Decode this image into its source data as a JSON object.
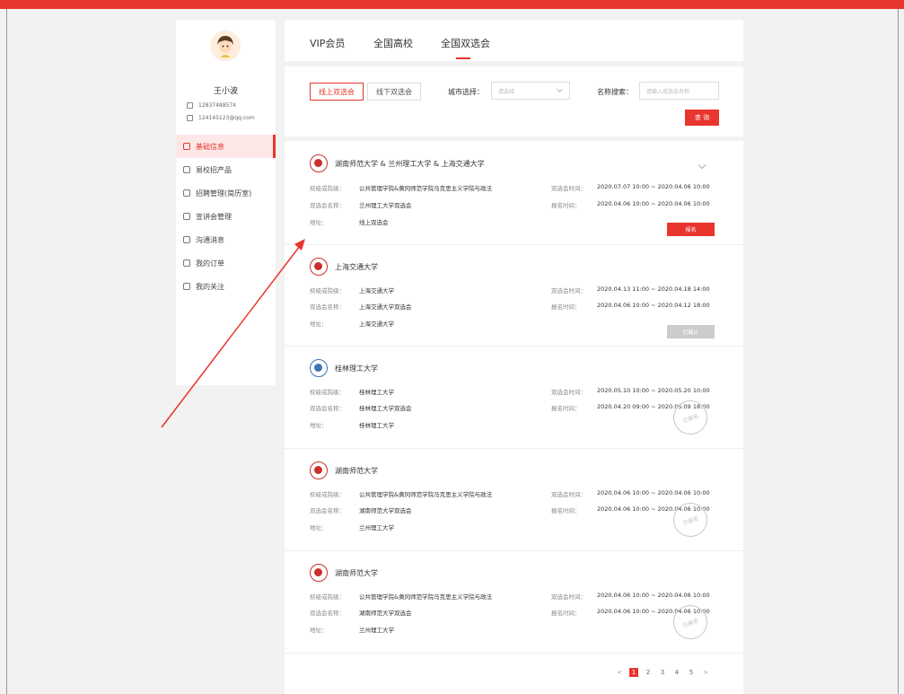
{
  "user": {
    "name": "王小波",
    "phone": "12837488574",
    "email": "124145123@qq.com"
  },
  "nav": [
    {
      "label": "基础信息",
      "icon": "home-icon",
      "active": true
    },
    {
      "label": "易校招产品",
      "icon": "grid-icon",
      "active": false
    },
    {
      "label": "招聘管理(简历室)",
      "icon": "user-icon",
      "active": false
    },
    {
      "label": "宣讲会管理",
      "icon": "eye-icon",
      "active": false
    },
    {
      "label": "沟通消息",
      "icon": "bell-icon",
      "active": false
    },
    {
      "label": "我的订单",
      "icon": "order-icon",
      "active": false
    },
    {
      "label": "我的关注",
      "icon": "heart-icon",
      "active": false
    }
  ],
  "tabs": [
    {
      "label": "VIP会员"
    },
    {
      "label": "全国高校"
    },
    {
      "label": "全国双选会"
    }
  ],
  "filter": {
    "online_label": "线上双选会",
    "offline_label": "线下双选会",
    "city_label": "城市选择：",
    "city_placeholder": "请选择",
    "name_label": "名称搜索：",
    "name_placeholder": "请输入双选会名称",
    "search_button": "查 询"
  },
  "labels": {
    "college": "校级或院级：",
    "fair_name": "双选会名称：",
    "address": "地址：",
    "fair_time": "双选会时间：",
    "signup_time": "报名时间："
  },
  "fairs": [
    {
      "title": "湖南师范大学 & 兰州理工大学 & 上海交通大学",
      "college": "公共管理学院&黄冈师范学院马克思主义学院与政法",
      "fair_name": "兰州理工大学双选会",
      "address": "线上双选会",
      "fair_time": "2020.07.07 10:00 ~ 2020.04.06 10:00",
      "signup_time": "2020.04.06 10:00 ~ 2020.04.06 10:00",
      "action": "报名"
    },
    {
      "title": "上海交通大学",
      "college": "上海交通大学",
      "fair_name": "上海交通大学双选会",
      "address": "上海交通大学",
      "fair_time": "2020.04.13 11:00 ~ 2020.04.18 14:00",
      "signup_time": "2020.04.06 10:00 ~ 2020.04.12 18:00",
      "action": "已截止"
    },
    {
      "title": "桂林理工大学",
      "college": "桂林理工大学",
      "fair_name": "桂林理工大学双选会",
      "address": "桂林理工大学",
      "fair_time": "2020.05.10 10:00 ~ 2020.05.20 10:00",
      "signup_time": "2020.04.20 09:00 ~ 2020.05.09 18:00",
      "stamp": "已报名"
    },
    {
      "title": "湖南师范大学",
      "college": "公共管理学院&黄冈师范学院马克思主义学院与政法",
      "fair_name": "湖南师范大学双选会",
      "address": "兰州理工大学",
      "fair_time": "2020.04.06 10:00 ~ 2020.04.06 10:00",
      "signup_time": "2020.04.06 10:00 ~ 2020.04.06 10:00",
      "stamp": "已报名"
    },
    {
      "title": "湖南师范大学",
      "college": "公共管理学院&黄冈师范学院马克思主义学院与政法",
      "fair_name": "湖南师范大学双选会",
      "address": "兰州理工大学",
      "fair_time": "2020.04.06 10:00 ~ 2020.04.06 10:00",
      "signup_time": "2020.04.06 10:00 ~ 2020.04.06 10:00",
      "stamp": "已报名"
    }
  ],
  "pagination": {
    "prev": "<",
    "pages": [
      "1",
      "2",
      "3",
      "4",
      "5"
    ],
    "next": ">",
    "current": "1"
  },
  "colors": {
    "accent": "#e8352e"
  }
}
